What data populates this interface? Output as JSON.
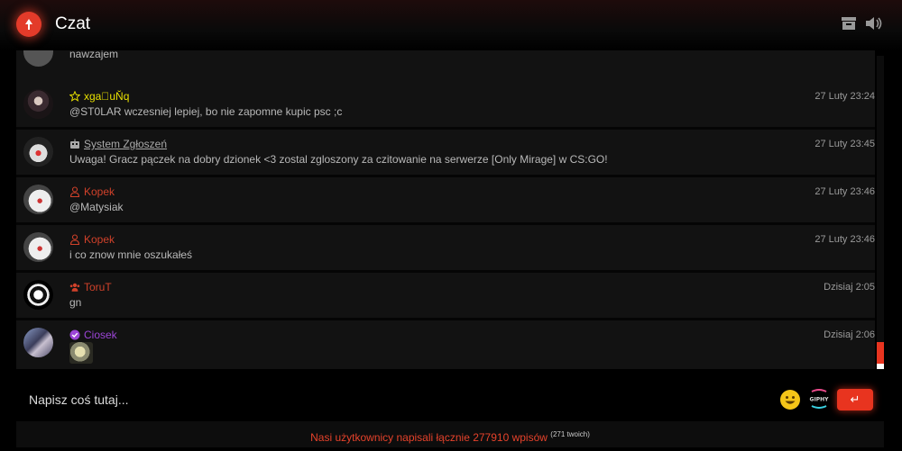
{
  "app": {
    "title": "Czat"
  },
  "header_icons": {
    "archive": "archive-icon",
    "volume": "volume-icon"
  },
  "partial_message": {
    "text": "nawzajem"
  },
  "messages": [
    {
      "user": "xgaᷜuŇq",
      "role_icon": "star-icon",
      "text": "@ST0LAR wczesniej lepiej, bo nie zapomne kupic psc ;c",
      "time": "27 Luty 23:24"
    },
    {
      "user": "System Zgłoszeń",
      "role_icon": "robot-icon",
      "text": "Uwaga! Gracz pączek na dobry dzionek <3 zostal zgloszony za czitowanie na serwerze [Only Mirage] w CS:GO!",
      "time": "27 Luty 23:45"
    },
    {
      "user": "Kopek",
      "role_icon": "user-icon",
      "text": "@Matysiak",
      "time": "27 Luty 23:46"
    },
    {
      "user": "Kopek",
      "role_icon": "user-icon",
      "text": "i co znow mnie oszukałeś",
      "time": "27 Luty 23:46"
    },
    {
      "user": "ToruT",
      "role_icon": "users-icon",
      "text": "gn",
      "time": "Dzisiaj 2:05"
    },
    {
      "user": "Ciosek",
      "role_icon": "verified-icon",
      "text": "",
      "time": "Dzisiaj 2:06"
    }
  ],
  "input": {
    "placeholder": "Napisz coś tutaj..."
  },
  "actions": {
    "emoji": "emoji-icon",
    "giphy": "giphy-icon",
    "send": "↵"
  },
  "stats": {
    "text": "Nasi użytkownicy napisali łącznie 277910 wpisów",
    "own": "(271 twoich)"
  },
  "colors": {
    "accent": "#e8341f",
    "yellow": "#e8e000",
    "red_user": "#d0412a",
    "purple_user": "#9b45d6"
  }
}
